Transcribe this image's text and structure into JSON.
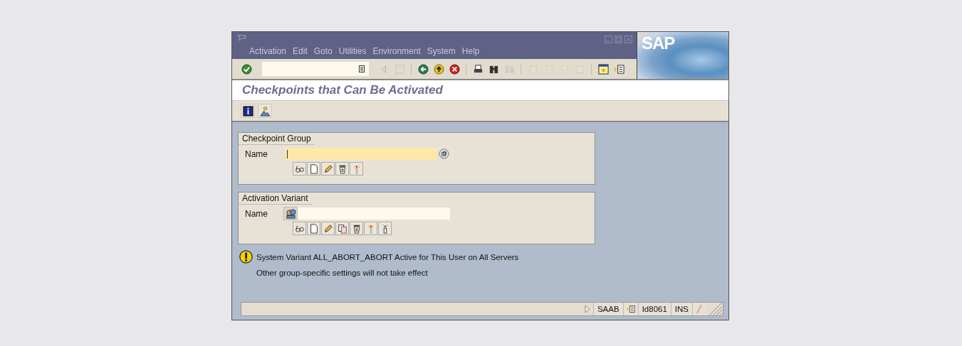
{
  "window": {
    "logo": "SAP",
    "menu": [
      {
        "label": "Activation"
      },
      {
        "label": "Edit"
      },
      {
        "label": "Goto"
      },
      {
        "label": "Utilities"
      },
      {
        "label": "Environment"
      },
      {
        "label": "System"
      },
      {
        "label": "Help"
      }
    ]
  },
  "toolbar": [
    {
      "kind": "enter",
      "disabled": false
    },
    {
      "kind": "command-field"
    },
    {
      "kind": "back-small",
      "disabled": true
    },
    {
      "kind": "save",
      "disabled": true
    },
    {
      "kind": "separator"
    },
    {
      "kind": "back",
      "disabled": false
    },
    {
      "kind": "exit",
      "disabled": false
    },
    {
      "kind": "cancel",
      "disabled": false
    },
    {
      "kind": "separator"
    },
    {
      "kind": "print",
      "disabled": false
    },
    {
      "kind": "find",
      "disabled": false
    },
    {
      "kind": "find-next",
      "disabled": true
    },
    {
      "kind": "separator"
    },
    {
      "kind": "first-page",
      "disabled": true
    },
    {
      "kind": "prev-page",
      "disabled": true
    },
    {
      "kind": "next-page",
      "disabled": true
    },
    {
      "kind": "last-page",
      "disabled": true
    },
    {
      "kind": "separator"
    },
    {
      "kind": "new-session",
      "disabled": false
    },
    {
      "kind": "shortcut",
      "disabled": false
    }
  ],
  "title": "Checkpoints that Can Be Activated",
  "app_toolbar": [
    {
      "kind": "info"
    },
    {
      "kind": "user"
    }
  ],
  "groups": [
    {
      "title": "Checkpoint Group",
      "label": "Name",
      "field": {
        "focused": true,
        "help": {
          "kind": "value-help"
        },
        "buttons": [
          {
            "kind": "display"
          },
          {
            "kind": "create"
          },
          {
            "kind": "change"
          },
          {
            "kind": "delete"
          },
          {
            "kind": "activate"
          }
        ]
      }
    },
    {
      "title": "Activation Variant",
      "label": "Name",
      "field": {
        "focused": false,
        "help": {
          "kind": "variant"
        },
        "buttons": [
          {
            "kind": "display"
          },
          {
            "kind": "create"
          },
          {
            "kind": "change"
          },
          {
            "kind": "copy"
          },
          {
            "kind": "delete"
          },
          {
            "kind": "activate"
          },
          {
            "kind": "deactivate"
          }
        ]
      }
    }
  ],
  "message": {
    "kind": "warning",
    "lines": [
      "System Variant ALL_ABORT_ABORT Active for This User on All Servers",
      "Other group-specific settings will not take effect"
    ]
  },
  "status_bar": {
    "system": "SAAB",
    "host": "Id8061",
    "mode": "INS"
  }
}
